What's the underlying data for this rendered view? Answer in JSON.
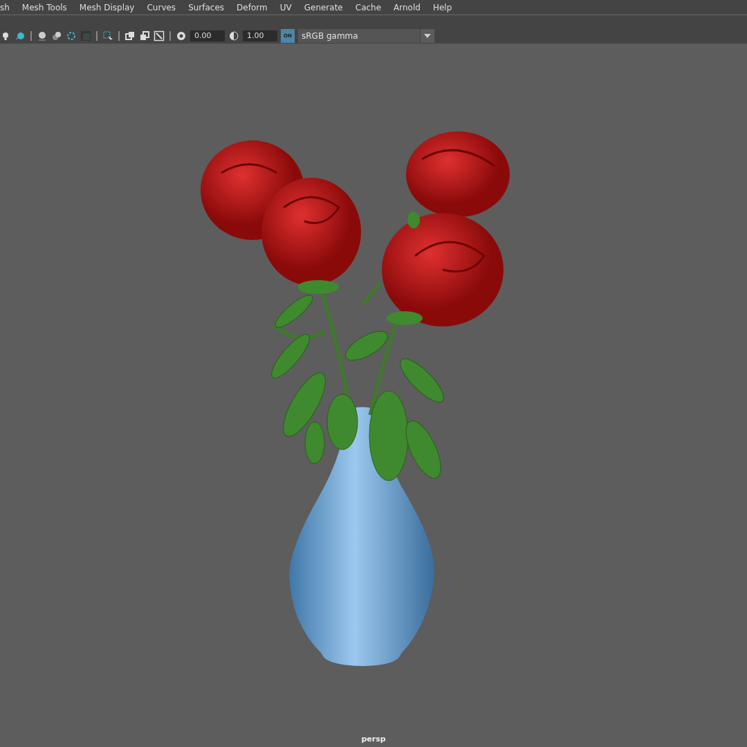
{
  "menu_bar": {
    "items": [
      "sh",
      "Mesh Tools",
      "Mesh Display",
      "Curves",
      "Surfaces",
      "Deform",
      "UV",
      "Generate",
      "Cache",
      "Arnold",
      "Help"
    ]
  },
  "toolbar": {
    "exposure_field": {
      "value": "0.00"
    },
    "gamma_field": {
      "value": "1.00"
    },
    "color_management_toggle": {
      "label": "ON",
      "on": true
    },
    "view_transform_dropdown": {
      "value": "sRGB gamma"
    }
  },
  "viewport": {
    "camera_label": "persp"
  }
}
